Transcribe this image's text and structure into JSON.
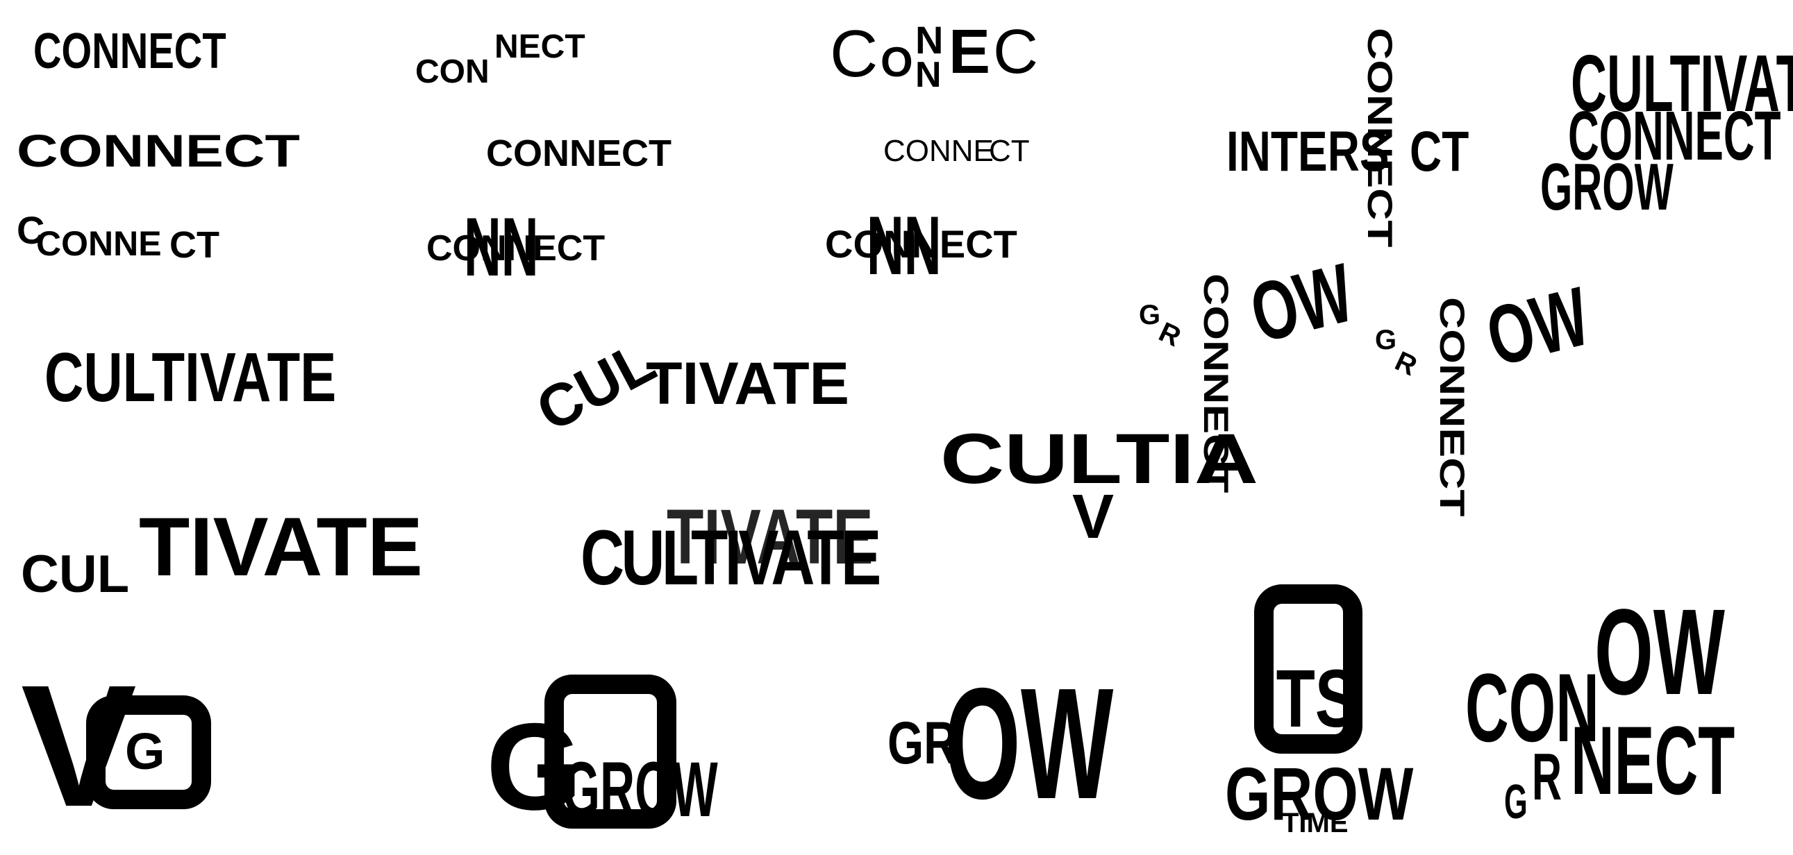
{
  "sheet": {
    "background": "#ffffff",
    "ink": "#000000",
    "words": {
      "connect": "CONNECT",
      "con": "CON",
      "nect": "NECT",
      "conne": "CONNE",
      "c": "C",
      "o": "O",
      "n": "N",
      "nn": "NN",
      "e": "E",
      "t": "T",
      "cultivate": "CULTIVATE",
      "cul": "CUL",
      "tivate": "TIVATE",
      "cultia": "CULTIA",
      "v": "V",
      "intersect": "INTERSECT",
      "inters": "INTERS",
      "ct": "CT",
      "grow": "GROW",
      "gr": "GR",
      "ow": "OW",
      "g": "G",
      "r": "R",
      "its": "ITS",
      "time": "TIME",
      "conow": "CONOW"
    }
  }
}
